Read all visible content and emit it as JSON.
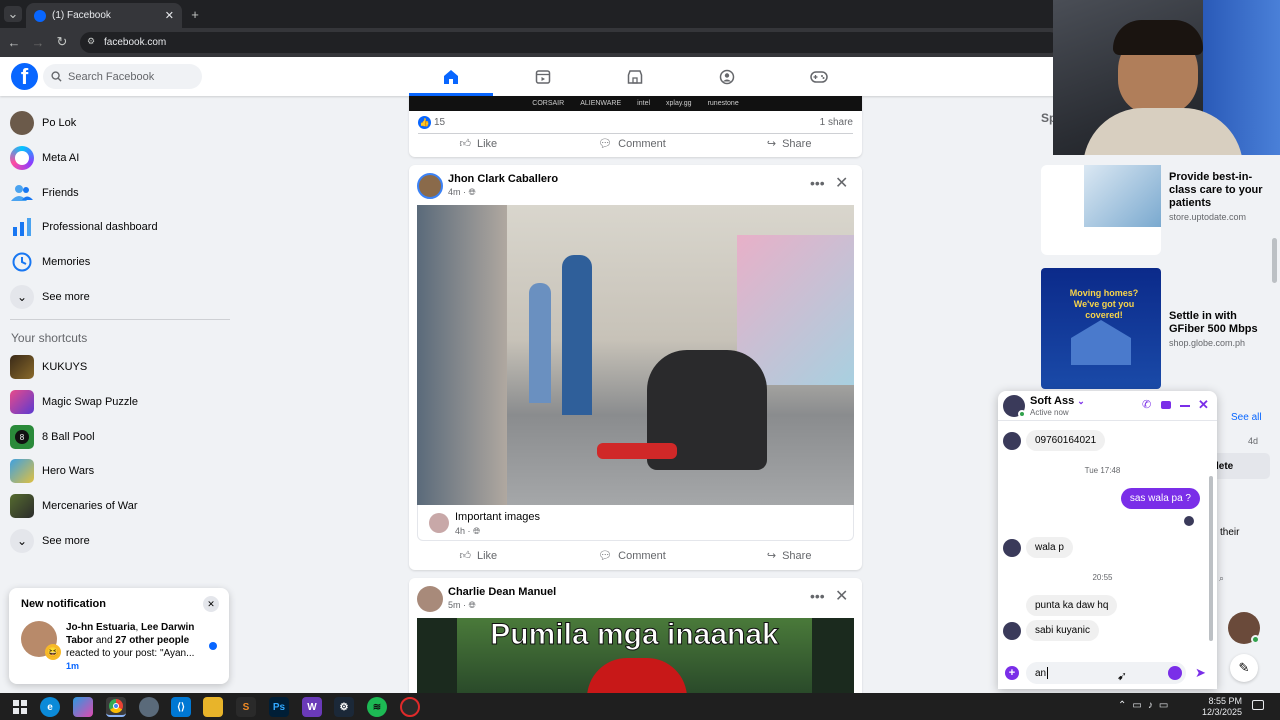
{
  "browser": {
    "tab_title": "(1) Facebook",
    "url": "facebook.com"
  },
  "header": {
    "search_placeholder": "Search Facebook"
  },
  "sidebar": {
    "items": [
      {
        "label": "Po Lok",
        "icon": "profile-avatar"
      },
      {
        "label": "Meta AI",
        "icon": "meta-ai-icon"
      },
      {
        "label": "Friends",
        "icon": "friends-icon"
      },
      {
        "label": "Professional dashboard",
        "icon": "dashboard-icon"
      },
      {
        "label": "Memories",
        "icon": "memories-icon"
      },
      {
        "label": "See more",
        "icon": "chevron-down-icon"
      }
    ],
    "shortcuts_heading": "Your shortcuts",
    "shortcuts": [
      {
        "label": "KUKUYS"
      },
      {
        "label": "Magic Swap Puzzle"
      },
      {
        "label": "8 Ball Pool"
      },
      {
        "label": "Hero Wars"
      },
      {
        "label": "Mercenaries of War"
      },
      {
        "label": "See more"
      }
    ]
  },
  "notification": {
    "heading": "New notification",
    "name1": "Jo-hn Estuaria",
    "sep1": ", ",
    "name2": "Lee Darwin Tabor",
    "and": " and ",
    "others": "27 other people",
    "text": " reacted to your post: \"Ayan...",
    "time": "1m"
  },
  "feed": {
    "top_post": {
      "sponsors": [
        "CORSAIR",
        "ALIENWARE",
        "intel",
        "xplay.gg",
        "runestone"
      ],
      "reaction_count": "15",
      "shares": "1 share",
      "like": "Like",
      "comment": "Comment",
      "share": "Share"
    },
    "post1": {
      "author": "Jhon Clark Caballero",
      "time": "4m · ",
      "shared_from": "Important images",
      "shared_time": "4h · ",
      "like": "Like",
      "comment": "Comment",
      "share": "Share"
    },
    "post2": {
      "author": "Charlie Dean Manuel",
      "time": "5m · ",
      "image_text": "Pumila mga inaanak"
    }
  },
  "right": {
    "sponsored_label": "Sp",
    "ads": [
      {
        "title": "Provide best-in-class care to your patients",
        "site": "store.uptodate.com"
      },
      {
        "title": "Settle in with GFiber 500 Mbps",
        "site": "shop.globe.com.ph",
        "img_text": "Moving homes? We've got you covered!"
      }
    ],
    "see_all": "See all",
    "age": "4d",
    "delete_partial": "lete",
    "their_partial": "their"
  },
  "chat": {
    "name": "Soft Ass",
    "status": "Active now",
    "messages": [
      {
        "dir": "in",
        "text": "09760164021"
      },
      {
        "dir": "time",
        "text": "Tue 17:48"
      },
      {
        "dir": "out",
        "text": "sas wala pa ?"
      },
      {
        "dir": "in",
        "text": "wala p"
      },
      {
        "dir": "time",
        "text": "20:55"
      },
      {
        "dir": "in",
        "text": "punta ka daw hq"
      },
      {
        "dir": "in",
        "text": "sabi kuyanic"
      }
    ],
    "input_value": "an"
  },
  "taskbar": {
    "time": "8:55 PM",
    "date": "12/3/2025"
  },
  "colors": {
    "fb_blue": "#0866ff",
    "messenger_purple": "#7a2ee8"
  }
}
